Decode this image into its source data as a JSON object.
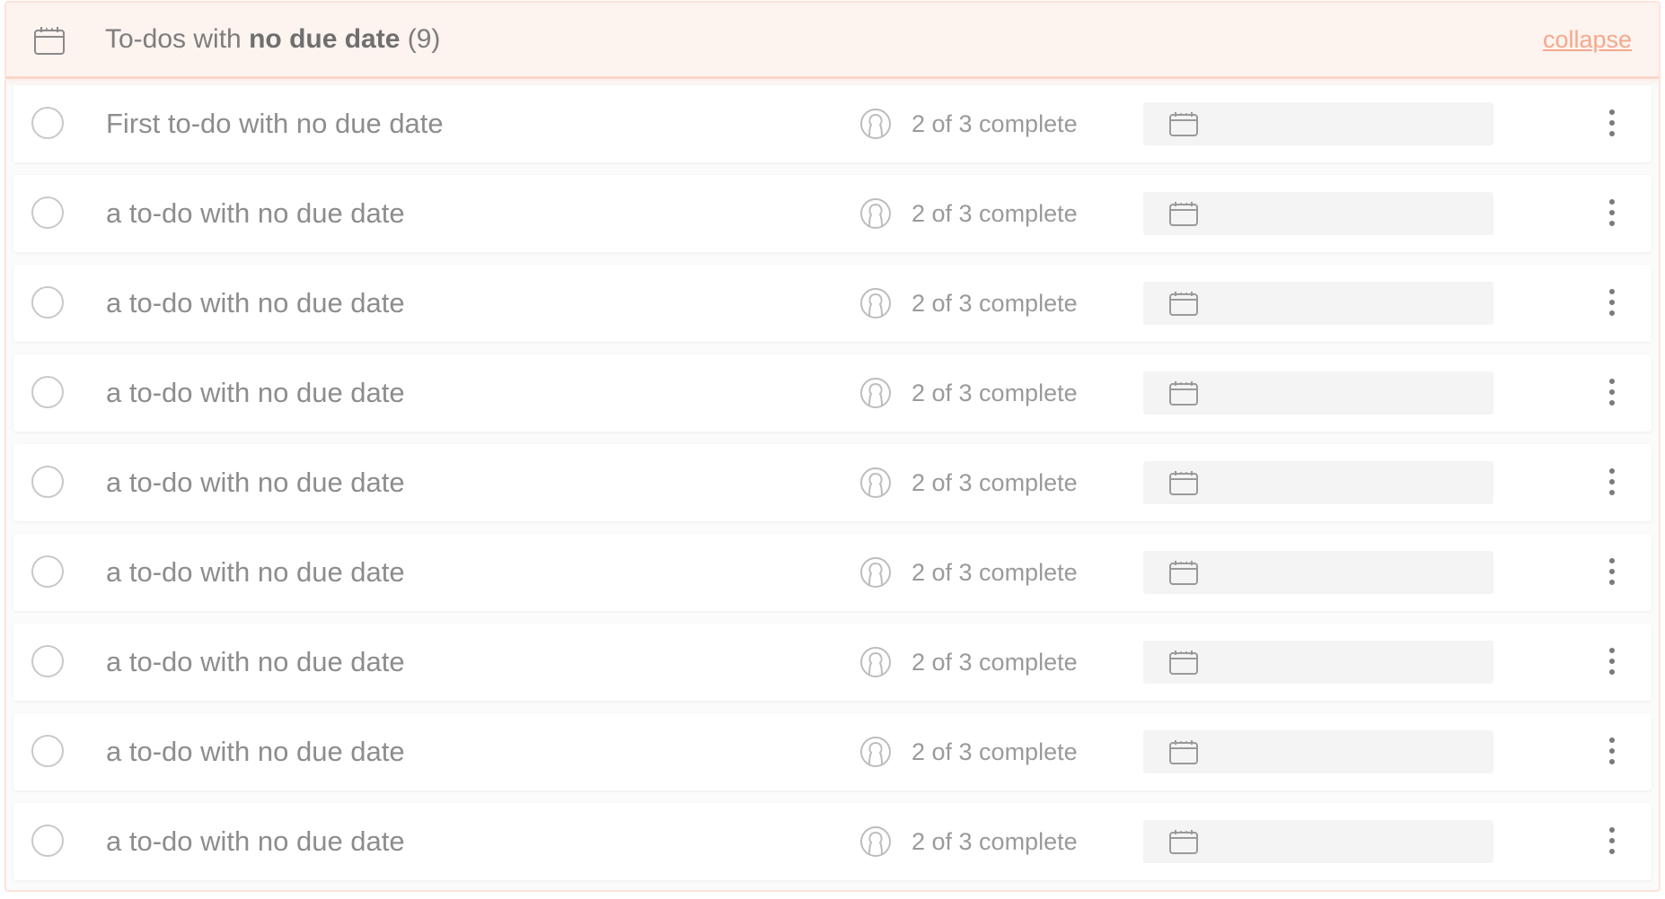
{
  "header": {
    "icon": "calendar-icon",
    "title_prefix": "To-dos with ",
    "title_bold": "no due date",
    "title_count": " (9)",
    "collapse_label": "collapse",
    "accent_color": "#f4a98c"
  },
  "todos": [
    {
      "title": "First to-do with no due date",
      "progress": "2 of 3 complete"
    },
    {
      "title": "a to-do with no due date",
      "progress": "2 of 3 complete"
    },
    {
      "title": "a to-do with no due date",
      "progress": "2 of 3 complete"
    },
    {
      "title": "a to-do with no due date",
      "progress": "2 of 3 complete"
    },
    {
      "title": "a to-do with no due date",
      "progress": "2 of 3 complete"
    },
    {
      "title": "a to-do with no due date",
      "progress": "2 of 3 complete"
    },
    {
      "title": "a to-do with no due date",
      "progress": "2 of 3 complete"
    },
    {
      "title": "a to-do with no due date",
      "progress": "2 of 3 complete"
    },
    {
      "title": "a to-do with no due date",
      "progress": "2 of 3 complete"
    }
  ],
  "icons": {
    "checkbox": "circle-checkbox-icon",
    "assignee": "user-avatar-icon",
    "date": "calendar-icon",
    "menu": "more-vertical-icon"
  }
}
